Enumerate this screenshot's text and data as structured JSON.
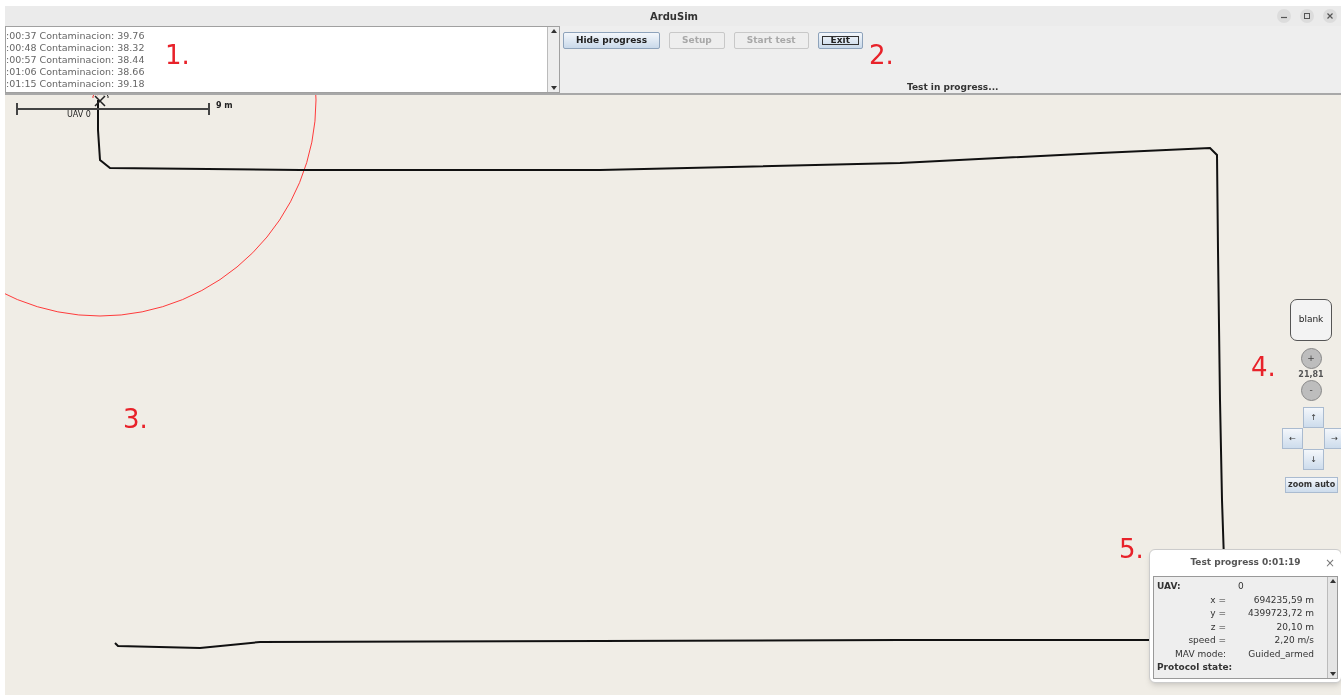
{
  "window": {
    "title": "ArduSim"
  },
  "log": {
    "lines": [
      ":00:37 Contaminacion: 39.76",
      ":00:48 Contaminacion: 38.32",
      ":00:57 Contaminacion: 38.44",
      ":01:06 Contaminacion: 38.66",
      ":01:15 Contaminacion: 39.18"
    ]
  },
  "buttons": [
    {
      "label": "Hide progress",
      "disabled": false,
      "focused": false
    },
    {
      "label": "Setup",
      "disabled": true,
      "focused": false
    },
    {
      "label": "Start test",
      "disabled": true,
      "focused": false
    },
    {
      "label": "Exit",
      "disabled": false,
      "focused": true
    }
  ],
  "status_text": "Test in progress...",
  "map": {
    "scale_label": "9 m",
    "uav_label": "UAV 0"
  },
  "map_controls": {
    "blank_label": "blank",
    "zoom_in": "+",
    "zoom_value": "21,81",
    "zoom_out": "-",
    "arrows": [
      "↑",
      "←",
      "→",
      "↓"
    ],
    "zoom_auto": "zoom auto"
  },
  "progress_window": {
    "title": "Test progress 0:01:19",
    "close": "×",
    "rows": [
      {
        "label": "UAV:",
        "value": "0",
        "kind": "header"
      },
      {
        "label": "x =",
        "value": "694235,59 m",
        "kind": "field"
      },
      {
        "label": "y =",
        "value": "4399723,72 m",
        "kind": "field"
      },
      {
        "label": "z =",
        "value": "20,10 m",
        "kind": "field"
      },
      {
        "label": "speed =",
        "value": "2,20 m/s",
        "kind": "field"
      },
      {
        "label": "MAV mode:",
        "value": "Guided_armed",
        "kind": "field"
      },
      {
        "label": "Protocol state:",
        "kind": "header"
      }
    ]
  },
  "annotations": [
    "1.",
    "2.",
    "3.",
    "4.",
    "5."
  ]
}
